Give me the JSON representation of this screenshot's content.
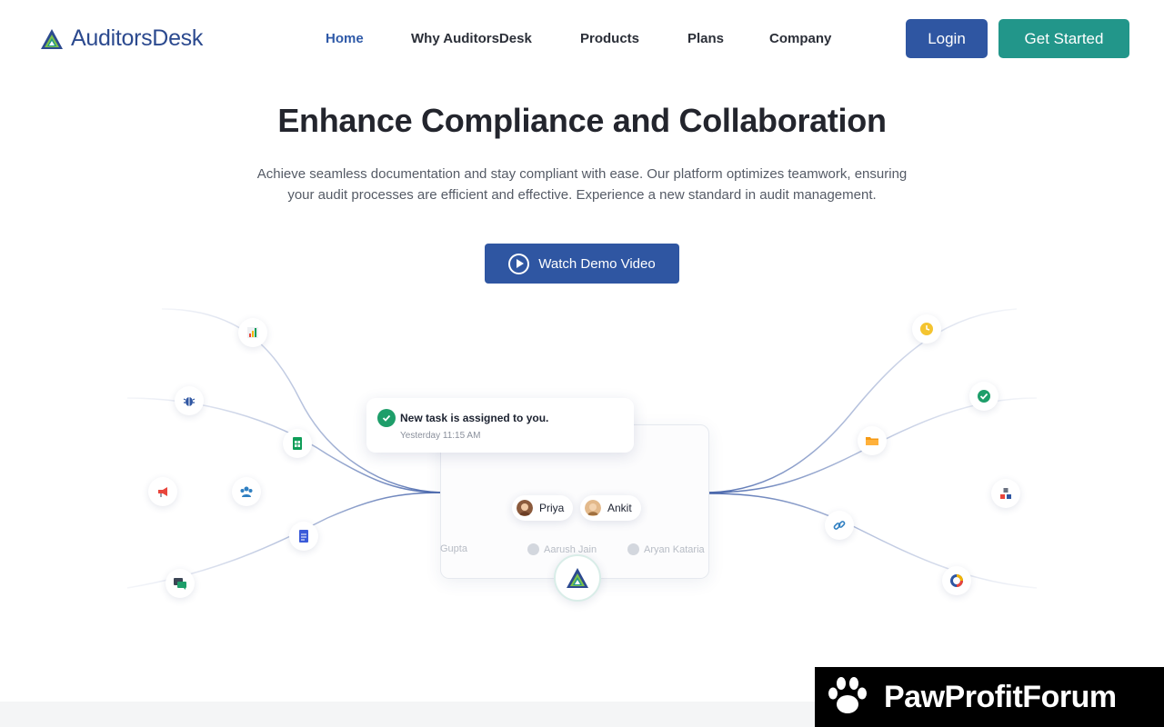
{
  "brand": {
    "name": "AuditorsDesk"
  },
  "nav": {
    "items": [
      {
        "label": "Home",
        "active": true
      },
      {
        "label": "Why AuditorsDesk",
        "active": false
      },
      {
        "label": "Products",
        "active": false
      },
      {
        "label": "Plans",
        "active": false
      },
      {
        "label": "Company",
        "active": false
      }
    ],
    "login_label": "Login",
    "get_started_label": "Get Started"
  },
  "hero": {
    "title": "Enhance Compliance and Collaboration",
    "description": "Achieve seamless documentation and stay compliant with ease. Our platform optimizes teamwork, ensuring your audit processes are efficient and effective. Experience a new standard in audit management.",
    "demo_label": "Watch Demo Video"
  },
  "illustration": {
    "notification": {
      "title": "New task is assigned to you.",
      "time": "Yesterday 11:15 AM"
    },
    "users": [
      "Priya",
      "Ankit"
    ],
    "faded_users": [
      "Gupta",
      "Aarush Jain",
      "Aryan Kataria"
    ],
    "left_icons": [
      "bar-chart-icon",
      "bug-icon",
      "spreadsheet-icon",
      "megaphone-icon",
      "team-icon",
      "document-icon",
      "chat-icon"
    ],
    "right_icons": [
      "clock-icon",
      "check-circle-icon",
      "folder-icon",
      "shapes-icon",
      "link-icon",
      "donut-chart-icon"
    ]
  },
  "watermark": {
    "text": "PawProfitForum"
  },
  "colors": {
    "primary": "#2f56a2",
    "accent": "#22968a",
    "heading": "#23252d",
    "active_nav": "#2f5aa8"
  }
}
